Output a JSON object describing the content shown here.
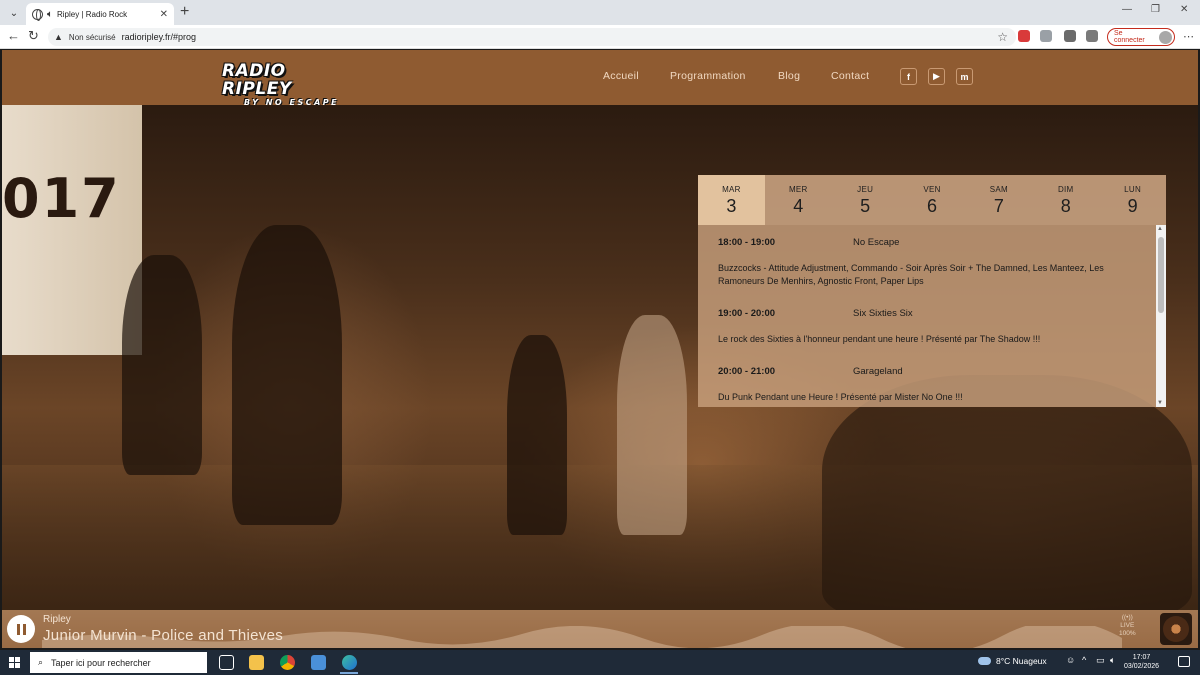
{
  "browser": {
    "tab_title": "Ripley | Radio Rock",
    "insecure_label": "Non sécurisé",
    "url": "radioripley.fr/#prog",
    "signin_label": "Se connecter"
  },
  "site": {
    "logo_line1": "RADIO RIPLEY",
    "logo_line2": "BY NO ESCAPE",
    "nav": [
      "Accueil",
      "Programmation",
      "Blog",
      "Contact"
    ],
    "social": [
      "facebook-icon",
      "youtube-icon",
      "mastodon-icon"
    ],
    "brand_color": "#8f5b31"
  },
  "hero": {
    "banner_text": "017"
  },
  "schedule": {
    "days": [
      {
        "name": "MAR",
        "num": "3",
        "active": true
      },
      {
        "name": "MER",
        "num": "4"
      },
      {
        "name": "JEU",
        "num": "5"
      },
      {
        "name": "VEN",
        "num": "6"
      },
      {
        "name": "SAM",
        "num": "7"
      },
      {
        "name": "DIM",
        "num": "8"
      },
      {
        "name": "LUN",
        "num": "9"
      }
    ],
    "programs": [
      {
        "time": "18:00 - 19:00",
        "name": "No Escape",
        "desc": "Buzzcocks - Attitude Adjustment, Commando - Soir Après Soir + The Damned, Les Manteez, Les Ramoneurs De Menhirs, Agnostic Front, Paper Lips"
      },
      {
        "time": "19:00 - 20:00",
        "name": "Six Sixties Six",
        "desc": "Le rock des Sixties à l'honneur pendant une heure ! Présenté par The Shadow !!!"
      },
      {
        "time": "20:00 - 21:00",
        "name": "Garageland",
        "desc": "Du Punk Pendant une Heure ! Présenté par Mister No One !!!"
      }
    ]
  },
  "player": {
    "station": "Ripley",
    "track": "Junior Murvin - Police and Thieves",
    "live_label": "LIVE",
    "volume": "100%"
  },
  "taskbar": {
    "search_placeholder": "Taper ici pour rechercher",
    "weather": "8°C  Nuageux",
    "time": "17:07",
    "date": "03/02/2026"
  }
}
